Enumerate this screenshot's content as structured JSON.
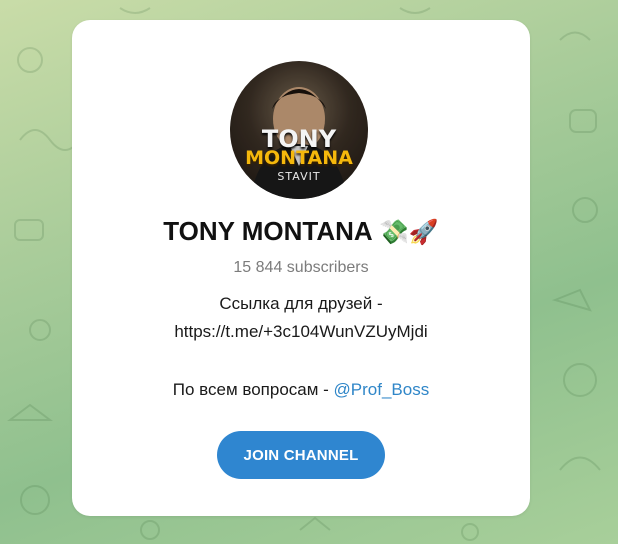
{
  "channel": {
    "avatar_text_line1": "TONY",
    "avatar_text_line2": "MONTANA",
    "avatar_text_line3": "STAVIT",
    "name": "TONY MONTANA",
    "name_emoji": "💸🚀",
    "subscribers": "15 844 subscribers",
    "description_line1": "Ссылка для друзей -",
    "description_link": "https://t.me/+3c104WunVZUyMjdi",
    "description_line3_prefix": "По всем вопросам - ",
    "description_mention": "@Prof_Boss"
  },
  "actions": {
    "join_label": "JOIN CHANNEL"
  },
  "colors": {
    "accent": "#2f86d0",
    "mention": "#2f86c8",
    "background_green": "#a9cc9a",
    "subtitle_gray": "#7c7c7c"
  }
}
